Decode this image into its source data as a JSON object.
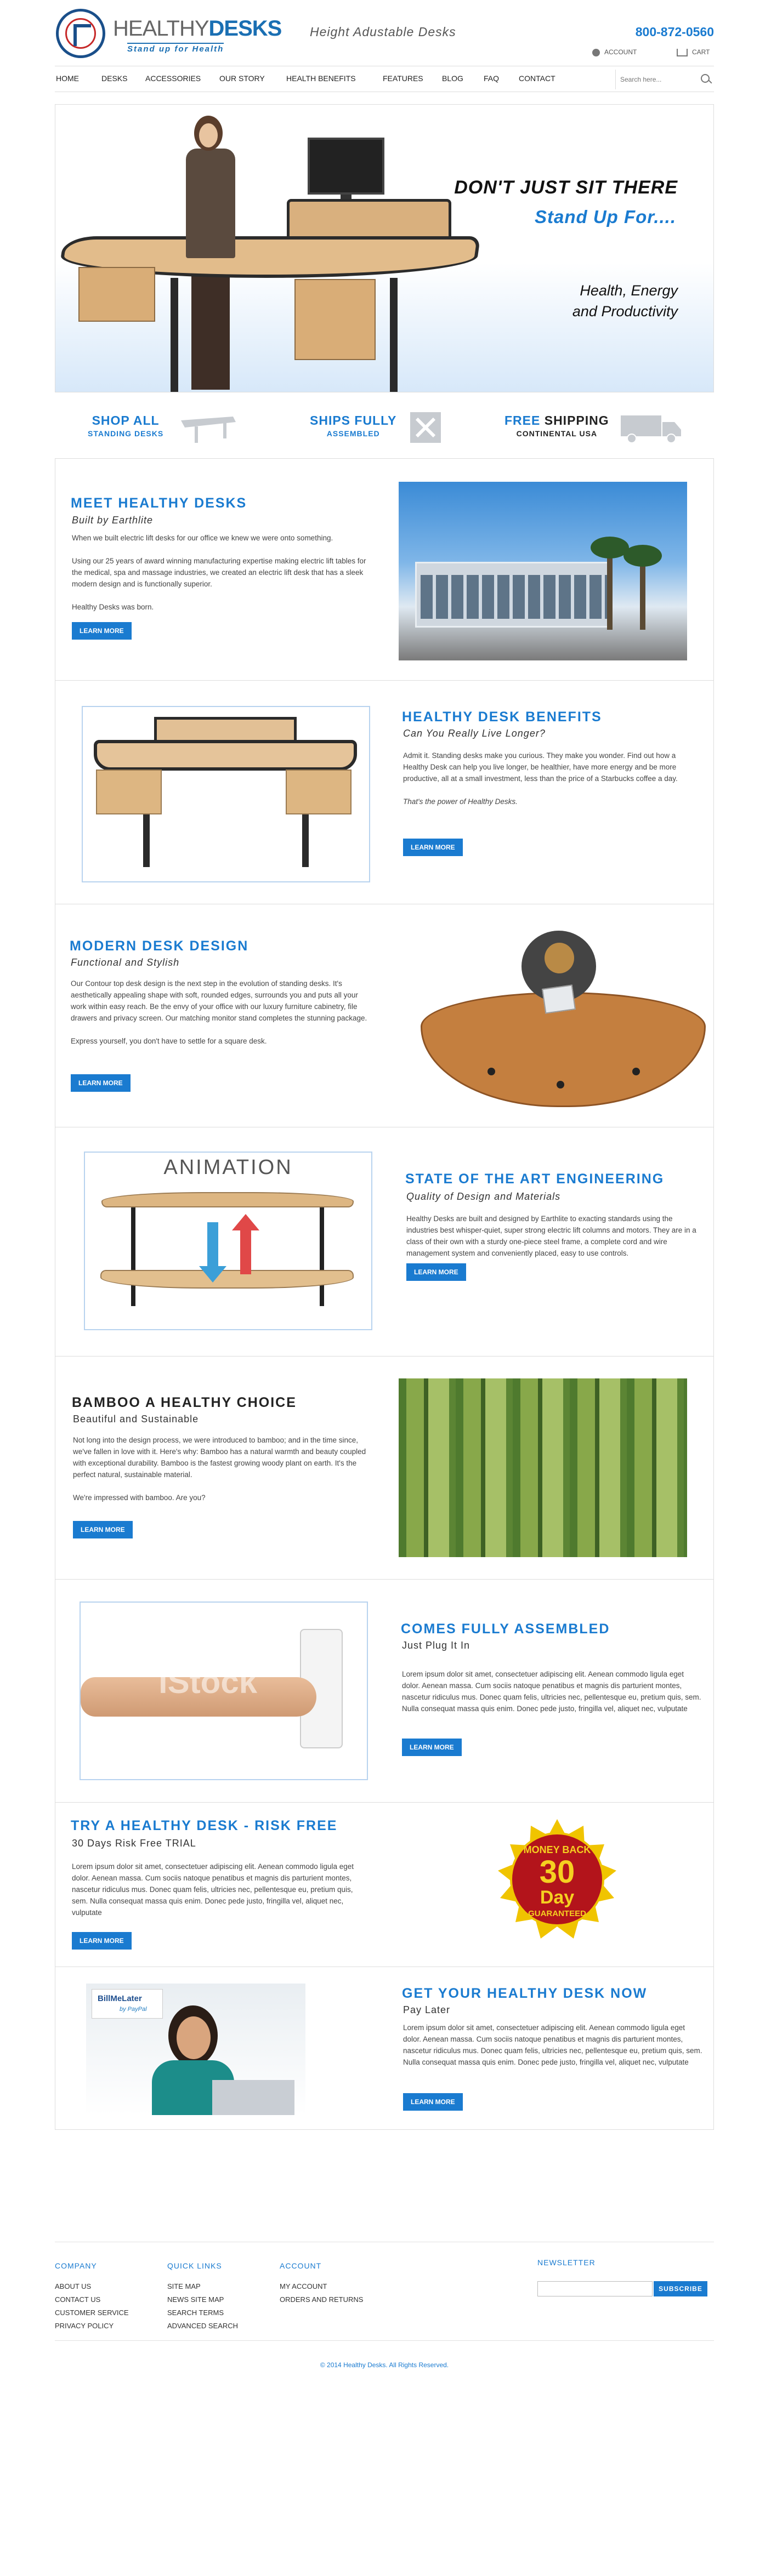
{
  "header": {
    "logo_text_light": "HEALTHY",
    "logo_text_bold": "DESKS",
    "logo_tagline": "Stand up for Health",
    "tagline": "Height Adustable Desks",
    "phone": "800-872-0560",
    "account_label": "ACCOUNT",
    "cart_label": "CART"
  },
  "nav": {
    "items": [
      "HOME",
      "DESKS",
      "ACCESSORIES",
      "OUR STORY",
      "HEALTH BENEFITS",
      "FEATURES",
      "BLOG",
      "FAQ",
      "CONTACT"
    ],
    "search_placeholder": "Search here..."
  },
  "hero": {
    "line1": "DON'T JUST SIT THERE",
    "line2": "Stand Up For....",
    "line3a": "Health, Energy",
    "line3b": "and Productivity"
  },
  "benefits": [
    {
      "line1": "SHOP ALL",
      "line2": "STANDING DESKS"
    },
    {
      "line1": "SHIPS FULLY",
      "line2": "ASSEMBLED"
    },
    {
      "line1_blue": "FREE",
      "line1_dark": "SHIPPING",
      "line2": "CONTINENTAL USA"
    }
  ],
  "sections": {
    "meet": {
      "title": "MEET HEALTHY DESKS",
      "subtitle": "Built by Earthlite",
      "p1": "When we built electric lift desks for our office we knew we were onto something.",
      "p2": "Using our 25 years of award winning manufacturing expertise making electric lift tables for the medical, spa and massage industries, we created an electric lift desk that has a sleek modern design and is functionally superior.",
      "p3": "Healthy Desks was born.",
      "button": "LEARN MORE"
    },
    "benefits": {
      "title": "HEALTHY DESK BENEFITS",
      "subtitle": "Can You Really Live Longer?",
      "p1": "Admit it. Standing desks make you curious. They make you wonder.  Find out how a Healthy Desk can help you live longer, be healthier, have more energy and be more productive, all at a small investment, less than the price of a Starbucks coffee a day.",
      "p2": "That's the power of Healthy Desks.",
      "button": "LEARN MORE"
    },
    "modern": {
      "title": "MODERN DESK DESIGN",
      "subtitle": "Functional and Stylish",
      "p1": "Our Contour top desk design is the next step in the evolution of standing desks. It's aesthetically appealing shape with soft, rounded edges, surrounds you and puts all your work within easy reach. Be the envy of your office with our luxury furniture cabinetry, file drawers and privacy screen. Our matching monitor stand completes the stunning package.",
      "p2": "Express yourself, you don't have to settle for a square desk.",
      "button": "LEARN MORE"
    },
    "engineering": {
      "animation_label": "ANIMATION",
      "title": "STATE OF THE ART ENGINEERING",
      "subtitle": "Quality of Design and Materials",
      "p1": "Healthy Desks are built and designed by Earthlite to exacting standards using the industries best whisper-quiet, super strong electric lift columns and motors. They are in a class of their own with a sturdy one-piece steel frame, a complete cord and wire management system and conveniently placed, easy to use controls.",
      "button": "LEARN MORE"
    },
    "bamboo": {
      "title": "BAMBOO A HEALTHY CHOICE",
      "subtitle": "Beautiful and Sustainable",
      "p1": "Not long into the design process, we were introduced to bamboo; and in the time since, we've fallen in love with it. Here's why: Bamboo has a natural warmth and beauty coupled with exceptional durability. Bamboo is the fastest growing woody plant on earth. It's the perfect natural, sustainable material.",
      "p2": "We're impressed with bamboo. Are you?",
      "button": "LEARN MORE"
    },
    "assembled": {
      "watermark": "iStock",
      "title": "COMES FULLY ASSEMBLED",
      "subtitle": "Just Plug It In",
      "p1": "Lorem ipsum dolor sit amet, consectetuer adipiscing elit. Aenean commodo ligula eget dolor. Aenean massa. Cum sociis natoque penatibus et magnis dis parturient montes, nascetur ridiculus mus. Donec quam felis, ultricies nec, pellentesque eu, pretium quis, sem. Nulla consequat massa quis enim. Donec pede justo, fringilla vel, aliquet nec, vulputate",
      "button": "LEARN MORE"
    },
    "riskfree": {
      "title": "TRY A HEALTHY DESK - RISK FREE",
      "subtitle": "30 Days Risk Free TRIAL",
      "p1": "Lorem ipsum dolor sit amet, consectetuer adipiscing elit. Aenean commodo ligula eget dolor. Aenean massa. Cum sociis natoque penatibus et magnis dis parturient montes, nascetur ridiculus mus. Donec quam felis, ultricies nec, pellentesque eu, pretium quis, sem. Nulla consequat massa quis enim. Donec pede justo, fringilla vel, aliquet nec, vulputate",
      "button": "LEARN MORE",
      "seal_top": "MONEY BACK",
      "seal_num": "30",
      "seal_day": "Day",
      "seal_bottom": "GUARANTEED"
    },
    "paylater": {
      "badge_line1": "BillMeLater",
      "badge_line2": "by PayPal",
      "title": "GET YOUR HEALTHY DESK NOW",
      "subtitle": "Pay Later",
      "p1": "Lorem ipsum dolor sit amet, consectetuer adipiscing elit. Aenean commodo ligula eget dolor. Aenean massa. Cum sociis natoque penatibus et magnis dis parturient montes, nascetur ridiculus mus. Donec quam felis, ultricies nec, pellentesque eu, pretium quis, sem. Nulla consequat massa quis enim. Donec pede justo, fringilla vel, aliquet nec, vulputate",
      "button": "LEARN MORE"
    }
  },
  "footer": {
    "company": {
      "title": "COMPANY",
      "links": [
        "ABOUT US",
        "CONTACT US",
        "CUSTOMER SERVICE",
        "PRIVACY POLICY"
      ]
    },
    "quicklinks": {
      "title": "QUICK LINKS",
      "links": [
        "SITE MAP",
        "NEWS SITE MAP",
        "SEARCH TERMS",
        "ADVANCED SEARCH"
      ]
    },
    "account": {
      "title": "ACCOUNT",
      "links": [
        "MY ACCOUNT",
        "ORDERS AND RETURNS"
      ]
    },
    "newsletter": {
      "title": "NEWSLETTER",
      "button": "SUBSCRIBE"
    },
    "copyright": "© 2014 Healthy Desks. All Rights Reserved."
  },
  "colors": {
    "accent": "#1a7bd0",
    "logo_navy": "#1a4f8a",
    "logo_red": "#c62828",
    "wood": "#d9ad77"
  }
}
